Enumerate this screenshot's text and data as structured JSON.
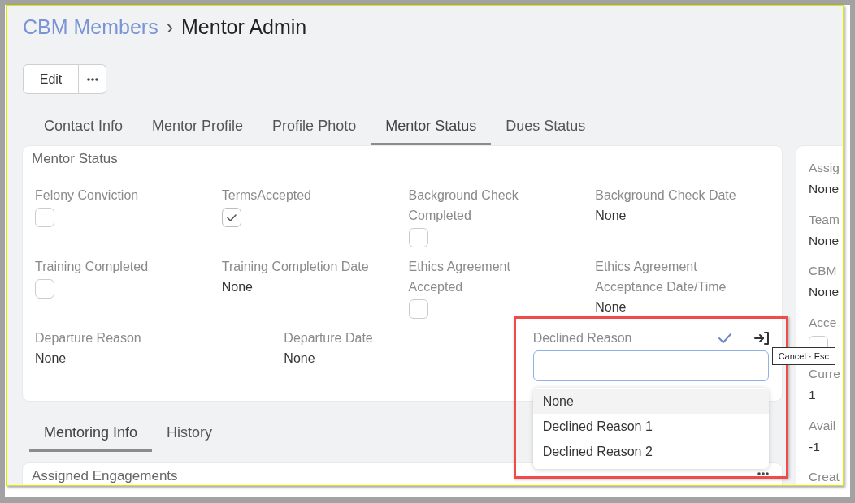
{
  "breadcrumb": {
    "parent": "CBM Members",
    "separator": "›",
    "current": "Mentor Admin"
  },
  "toolbar": [
    {
      "kind": "text",
      "label": "Edit"
    },
    {
      "kind": "more"
    }
  ],
  "tabs": [
    {
      "label": "Contact Info",
      "selected": false
    },
    {
      "label": "Mentor Profile",
      "selected": false
    },
    {
      "label": "Profile Photo",
      "selected": false
    },
    {
      "label": "Mentor Status",
      "selected": true
    },
    {
      "label": "Dues Status",
      "selected": false
    }
  ],
  "mentor_status": {
    "title": "Mentor Status",
    "fields": [
      {
        "kind": "checkbox",
        "label": "Felony Conviction",
        "checked": false
      },
      {
        "kind": "checkbox",
        "label": "TermsAccepted",
        "checked": true
      },
      {
        "kind": "checkbox",
        "label": "Background Check Completed",
        "checked": false
      },
      {
        "kind": "value",
        "label": "Background Check Date",
        "value": "None"
      },
      {
        "kind": "checkbox",
        "label": "Training Completed",
        "checked": false
      },
      {
        "kind": "value",
        "label": "Training Completion Date",
        "value": "None"
      },
      {
        "kind": "checkbox",
        "label": "Ethics Agreement Accepted",
        "checked": false
      },
      {
        "kind": "value",
        "label": "Ethics Agreement Acceptance Date/Time",
        "value": "None"
      }
    ],
    "departure_fields": [
      {
        "kind": "value",
        "label": "Departure Reason",
        "value": "None"
      },
      {
        "kind": "value",
        "label": "Departure Date",
        "value": "None"
      },
      {
        "kind": "select_editing",
        "label": "Declined Reason",
        "tooltip": "Cancel · Esc",
        "options": [
          {
            "label": "None",
            "selected": true
          },
          {
            "label": "Declined Reason 1",
            "selected": false
          },
          {
            "label": "Declined Reason 2",
            "selected": false
          }
        ]
      }
    ]
  },
  "section_tabs": [
    {
      "label": "Mentoring Info",
      "selected": true
    },
    {
      "label": "History",
      "selected": false
    }
  ],
  "engagements": {
    "title": "Assigned Engagements"
  },
  "side_panel": {
    "fields": [
      {
        "kind": "value",
        "label": "Assig",
        "value": "None"
      },
      {
        "kind": "value",
        "label": "Team",
        "value": "None"
      },
      {
        "kind": "value",
        "label": "CBM",
        "value": "None"
      },
      {
        "kind": "checkbox",
        "label": "Acce",
        "checked": false
      },
      {
        "kind": "value",
        "label": "Curre",
        "value": "1"
      },
      {
        "kind": "value",
        "label": "Avail",
        "value": "-1"
      },
      {
        "kind": "value",
        "label": "Creat"
      }
    ]
  }
}
